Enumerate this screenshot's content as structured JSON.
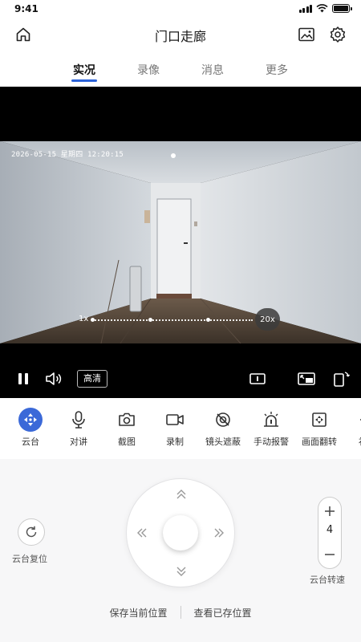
{
  "status": {
    "time": "9:41"
  },
  "header": {
    "title": "门口走廊",
    "icons": [
      "home-icon",
      "gallery-icon",
      "gear-icon"
    ]
  },
  "tabs": [
    {
      "label": "实况",
      "active": true
    },
    {
      "label": "录像",
      "active": false
    },
    {
      "label": "消息",
      "active": false
    },
    {
      "label": "更多",
      "active": false
    }
  ],
  "video": {
    "timestamp": "2026-05-15 星期四 12:20:15",
    "zoom_min": "1x",
    "zoom_max": "20x",
    "quality_label": "高清",
    "controls": [
      "pause-icon",
      "volume-icon",
      "info-icon",
      "pip-icon",
      "rotate-icon"
    ]
  },
  "tools": [
    {
      "label": "云台",
      "icon": "ptz-icon",
      "active": true
    },
    {
      "label": "对讲",
      "icon": "mic-icon",
      "active": false
    },
    {
      "label": "截图",
      "icon": "camera-icon",
      "active": false
    },
    {
      "label": "录制",
      "icon": "video-record-icon",
      "active": false
    },
    {
      "label": "镜头遮蔽",
      "icon": "lens-cover-icon",
      "active": false
    },
    {
      "label": "手动报警",
      "icon": "alarm-icon",
      "active": false
    },
    {
      "label": "画面翻转",
      "icon": "flip-icon",
      "active": false
    },
    {
      "label": "补光",
      "icon": "light-icon",
      "active": false
    }
  ],
  "ptz": {
    "reset_label": "云台复位",
    "speed_value": "4",
    "speed_label": "云台转速",
    "save_position": "保存当前位置",
    "view_positions": "查看已存位置"
  },
  "colors": {
    "accent": "#2b62d9",
    "ptz_active": "#3b69d8"
  }
}
